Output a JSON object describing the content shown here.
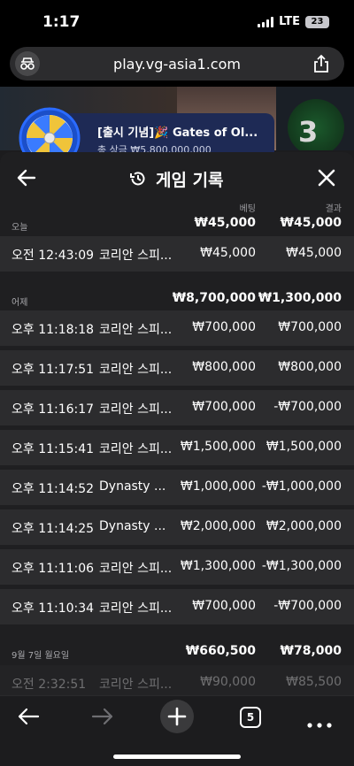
{
  "status_bar": {
    "time": "1:17",
    "network": "LTE",
    "battery": "23"
  },
  "browser": {
    "url": "play.vg-asia1.com"
  },
  "background_game": {
    "number": "3"
  },
  "promo": {
    "title": "[출시 기념]🎉 Gates of Ol...",
    "subtitle": "총 상금 ₩5,800,000,000"
  },
  "panel": {
    "title": "게임 기록",
    "col_bet": "베팅",
    "col_result": "결과"
  },
  "groups": [
    {
      "label": "오늘",
      "bet_total": "₩45,000",
      "result_total": "₩45,000",
      "rows": [
        {
          "time": "오전 12:43:09",
          "game": "코리안 스피...",
          "bet": "₩45,000",
          "result": "₩45,000"
        }
      ]
    },
    {
      "label": "어제",
      "bet_total": "₩8,700,000",
      "result_total": "₩1,300,000",
      "rows": [
        {
          "time": "오후 11:18:18",
          "game": "코리안 스피...",
          "bet": "₩700,000",
          "result": "₩700,000"
        },
        {
          "time": "오후 11:17:51",
          "game": "코리안 스피...",
          "bet": "₩800,000",
          "result": "₩800,000"
        },
        {
          "time": "오후 11:16:17",
          "game": "코리안 스피...",
          "bet": "₩700,000",
          "result": "-₩700,000"
        },
        {
          "time": "오후 11:15:41",
          "game": "코리안 스피...",
          "bet": "₩1,500,000",
          "result": "₩1,500,000"
        },
        {
          "time": "오후 11:14:52",
          "game": "Dynasty ...",
          "bet": "₩1,000,000",
          "result": "-₩1,000,000"
        },
        {
          "time": "오후 11:14:25",
          "game": "Dynasty ...",
          "bet": "₩2,000,000",
          "result": "₩2,000,000"
        },
        {
          "time": "오후 11:11:06",
          "game": "코리안 스피...",
          "bet": "₩1,300,000",
          "result": "-₩1,300,000"
        },
        {
          "time": "오후 11:10:34",
          "game": "코리안 스피...",
          "bet": "₩700,000",
          "result": "-₩700,000"
        }
      ]
    },
    {
      "label": "9월 7일 월요일",
      "bet_total": "₩660,500",
      "result_total": "₩78,000",
      "rows": [
        {
          "time": "오전 2:32:51",
          "game": "코리안 스피...",
          "bet": "₩90,000",
          "result": "₩85,500"
        }
      ]
    }
  ],
  "toolbar": {
    "tab_count": "5"
  },
  "icons": {
    "tracker": "privacy-shield-icon",
    "share": "share-icon",
    "back": "back-arrow-icon",
    "history": "history-icon",
    "close": "close-icon",
    "nav_back": "nav-back-icon",
    "nav_forward": "nav-forward-icon",
    "new_tab": "plus-icon",
    "tabs": "tabs-icon",
    "more": "more-icon"
  }
}
